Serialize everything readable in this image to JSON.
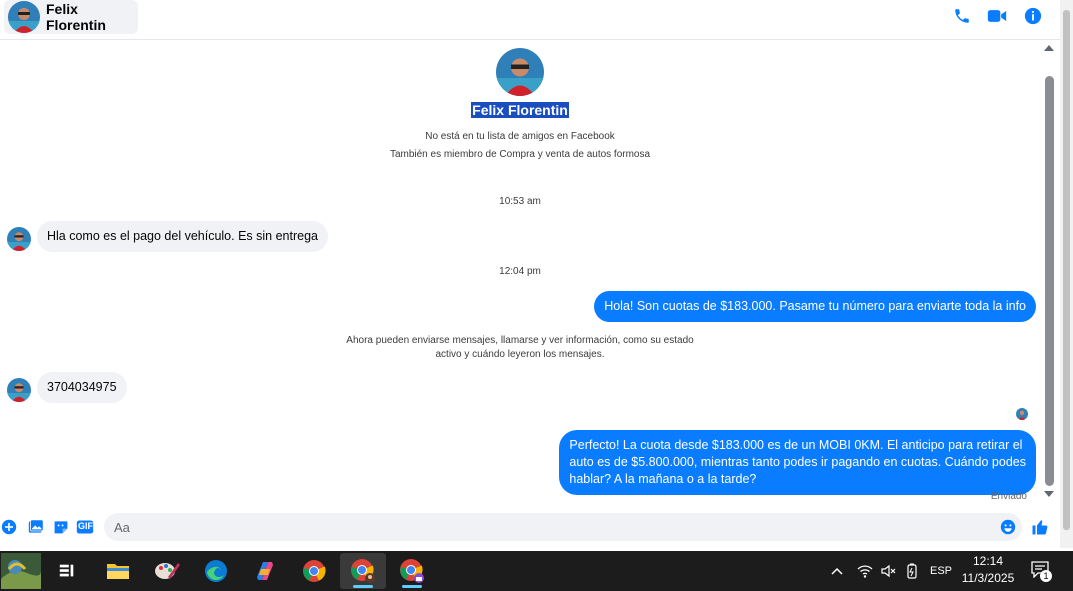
{
  "header": {
    "contact_name": "Felix Florentin",
    "icons": [
      "phone-icon",
      "video-camera-icon",
      "info-icon"
    ]
  },
  "profile": {
    "name": "Felix Florentin",
    "line1": "No está en tu lista de amigos en Facebook",
    "line2": "También es miembro de Compra y venta de autos formosa"
  },
  "conversation": {
    "timestamp1": "10:53 am",
    "msg1": "Hla como es el pago del vehículo. Es sin entrega",
    "timestamp2": "12:04 pm",
    "msg2": "Hola! Son cuotas de $183.000. Pasame tu número para enviarte toda la info",
    "notice_line1": "Ahora pueden enviarse mensajes, llamarse y ver información, como su estado",
    "notice_line2": "activo y cuándo leyeron los mensajes.",
    "msg3": "3704034975",
    "msg4_line1": "Perfecto! La cuota desde $183.000 es de un MOBI 0KM. El anticipo para retirar el",
    "msg4_line2": "auto es de $5.800.000, mientras tanto podes ir pagando en cuotas. Cuándo podes",
    "msg4_line3": "hablar? A la mañana o a la tarde?",
    "status": "Enviado"
  },
  "composer": {
    "placeholder": "Aa",
    "gif_label": "GIF",
    "icons": [
      "plus-icon",
      "image-icon",
      "sticker-icon",
      "gif-icon",
      "emoji-icon",
      "thumbs-up-icon"
    ]
  },
  "taskbar": {
    "apps": [
      "widgets-icon",
      "task-view-icon",
      "file-explorer-icon",
      "paint-icon",
      "edge-icon",
      "copilot-icon",
      "chrome-icon",
      "chrome-profile-icon",
      "chrome-incognito-icon"
    ],
    "language": "ESP",
    "time": "12:14",
    "date": "11/3/2025",
    "notification_count": "1"
  },
  "colors": {
    "accent": "#0a7cff",
    "incoming_bubble": "#f0f2f5",
    "taskbar": "#1c1c1c"
  }
}
